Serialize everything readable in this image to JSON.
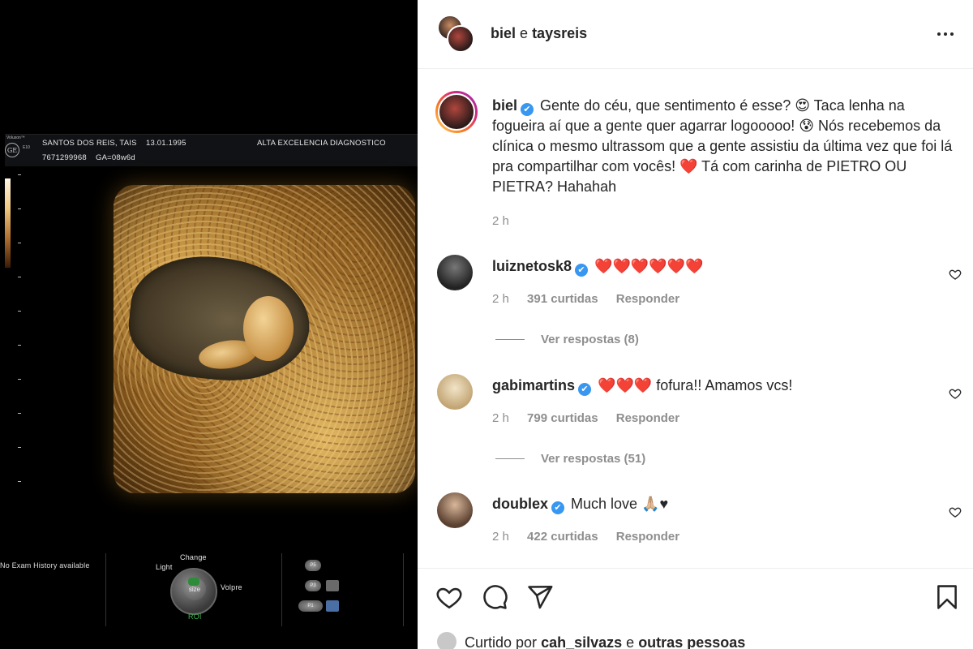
{
  "ultrasound": {
    "brand_small": "Voluson™",
    "model_small": "E10",
    "ge_logo": "GE",
    "patient": "SANTOS DOS REIS, TAIS",
    "dob": "13.01.1995",
    "clinic": "ALTA EXCELENCIA DIAGNOSTICO",
    "patient_id": "7671299968",
    "ga": "GA=08w6d",
    "exam_history": "No Exam History available",
    "ctrl_change": "Change",
    "ctrl_light": "Light",
    "ctrl_volpre": "Volpre",
    "ctrl_size": "size",
    "ctrl_roi": "ROI",
    "btn_p5": "P5",
    "btn_p3": "P3",
    "btn_p1": "P1"
  },
  "header": {
    "user1": "biel",
    "conjunction": "e",
    "user2": "taysreis",
    "more_icon": "more-horizontal-icon"
  },
  "caption": {
    "username": "biel",
    "text": "Gente do céu, que sentimento é esse? 😍 Taca lenha na fogueira aí que a gente quer agarrar logooooo! 😰 Nós recebemos da clínica o mesmo ultrassom que a gente assistiu da última vez que foi lá pra compartilhar com vocês! ❤️ Tá com carinha de PIETRO OU PIETRA? Hahahah",
    "time": "2 h"
  },
  "comments": [
    {
      "username": "luiznetosk8",
      "text": "❤️❤️❤️❤️❤️❤️",
      "time": "2 h",
      "likes": "391 curtidas",
      "reply": "Responder",
      "view_replies": "Ver respostas (8)",
      "avatar_color": "#3a3a3a"
    },
    {
      "username": "gabimartins",
      "text": "❤️❤️❤️ fofura!! Amamos vcs!",
      "time": "2 h",
      "likes": "799 curtidas",
      "reply": "Responder",
      "view_replies": "Ver respostas (51)",
      "avatar_color": "#d9c39a"
    },
    {
      "username": "doublex",
      "text": "Much love 🙏🏼♥",
      "time": "2 h",
      "likes": "422 curtidas",
      "reply": "Responder",
      "avatar_color": "#8b6e5a"
    }
  ],
  "actions": {
    "like_icon": "heart-icon",
    "comment_icon": "comment-icon",
    "share_icon": "send-icon",
    "save_icon": "bookmark-icon"
  },
  "liked_by": {
    "prefix": "Curtido por",
    "user": "cah_silvazs",
    "connector": "e",
    "others": "outras pessoas"
  },
  "verified_mark": "✔",
  "colors": {
    "text": "#262626",
    "muted": "#8e8e8e",
    "verified": "#3897f0",
    "divider": "#efefef"
  }
}
